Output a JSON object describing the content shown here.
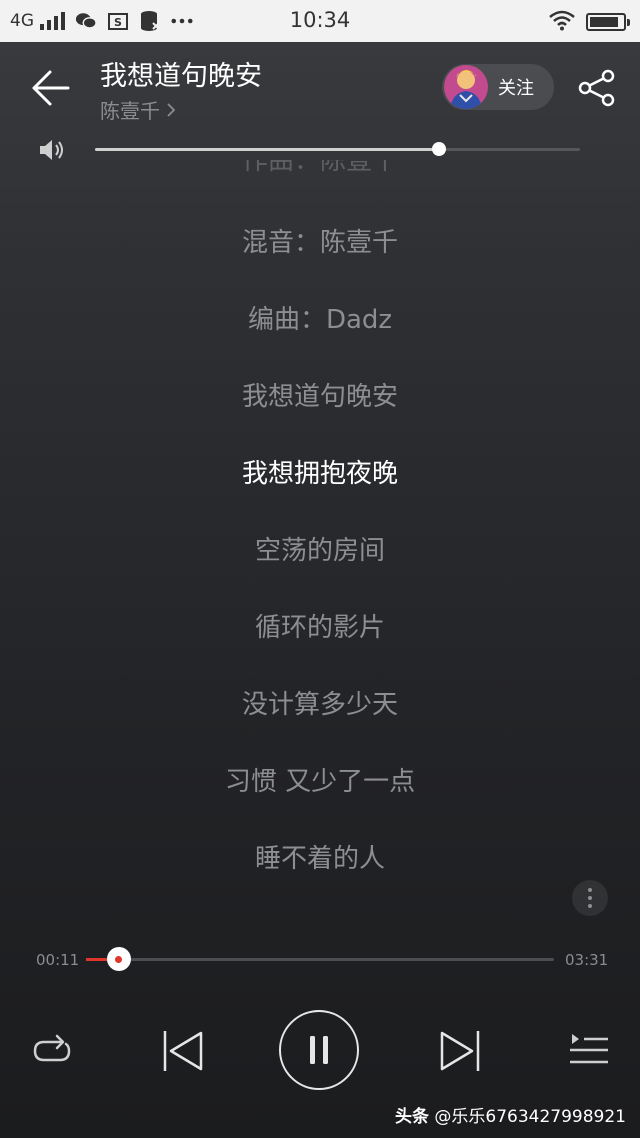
{
  "status_bar": {
    "network": "4G",
    "time": "10:34",
    "battery_level": 0.9,
    "icons": [
      "wechat-icon",
      "screenshot-icon",
      "data-icon",
      "more-dots-icon",
      "wifi-icon",
      "battery-icon"
    ]
  },
  "header": {
    "title": "我想道句晚安",
    "artist": "陈壹千",
    "follow_label": "关注",
    "back_icon": "arrow-left-icon",
    "share_icon": "share-icon"
  },
  "volume": {
    "level": 0.71,
    "icon": "speaker-icon"
  },
  "lyrics": {
    "partial_above": "作曲：陈壹千",
    "lines": [
      "混音：陈壹千",
      "编曲：Dadz",
      "我想道句晚安",
      "我想拥抱夜晚",
      "空荡的房间",
      "循环的影片",
      "没计算多少天",
      "习惯 又少了一点",
      "睡不着的人"
    ],
    "current_index": 3
  },
  "progress": {
    "elapsed": "00:11",
    "total": "03:31",
    "fraction": 0.07
  },
  "controls": {
    "icons": [
      "repeat-icon",
      "previous-icon",
      "pause-icon",
      "next-icon",
      "playlist-icon"
    ]
  },
  "watermark": {
    "brand": "头条",
    "handle": "@乐乐6763427998921"
  },
  "colors": {
    "accent": "#e0352b",
    "lyric_dim": "#8d8e91",
    "lyric_current": "#ffffff"
  }
}
